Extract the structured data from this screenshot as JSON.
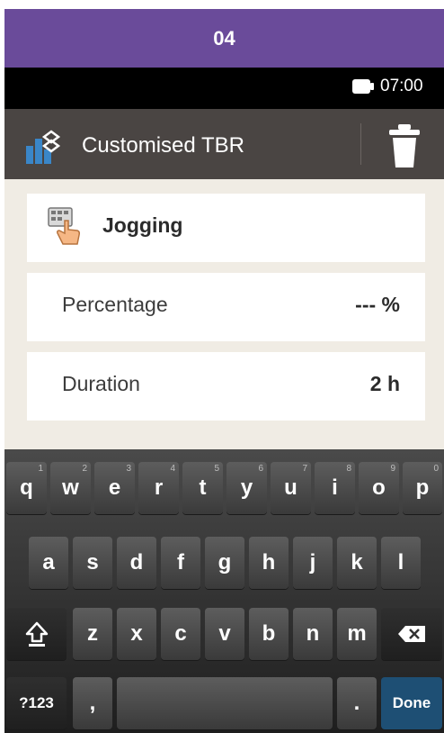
{
  "step_banner": "04",
  "status": {
    "time": "07:00"
  },
  "header": {
    "title": "Customised TBR"
  },
  "cards": {
    "activity": "Jogging",
    "percentage": {
      "label": "Percentage",
      "value": "--- %"
    },
    "duration": {
      "label": "Duration",
      "value": "2 h"
    }
  },
  "keyboard": {
    "row1": [
      {
        "key": "q",
        "hint": "1"
      },
      {
        "key": "w",
        "hint": "2"
      },
      {
        "key": "e",
        "hint": "3"
      },
      {
        "key": "r",
        "hint": "4"
      },
      {
        "key": "t",
        "hint": "5"
      },
      {
        "key": "y",
        "hint": "6"
      },
      {
        "key": "u",
        "hint": "7"
      },
      {
        "key": "i",
        "hint": "8"
      },
      {
        "key": "o",
        "hint": "9"
      },
      {
        "key": "p",
        "hint": "0"
      }
    ],
    "row2": [
      "a",
      "s",
      "d",
      "f",
      "g",
      "h",
      "j",
      "k",
      "l"
    ],
    "row3": [
      "z",
      "x",
      "c",
      "v",
      "b",
      "n",
      "m"
    ],
    "mode_key": "?123",
    "comma_key": ",",
    "period_key": ".",
    "done_key": "Done"
  },
  "colors": {
    "banner": "#6a4b9a",
    "header": "#4a4543",
    "content_bg": "#f0ece4",
    "done_key": "#1e4f74"
  }
}
